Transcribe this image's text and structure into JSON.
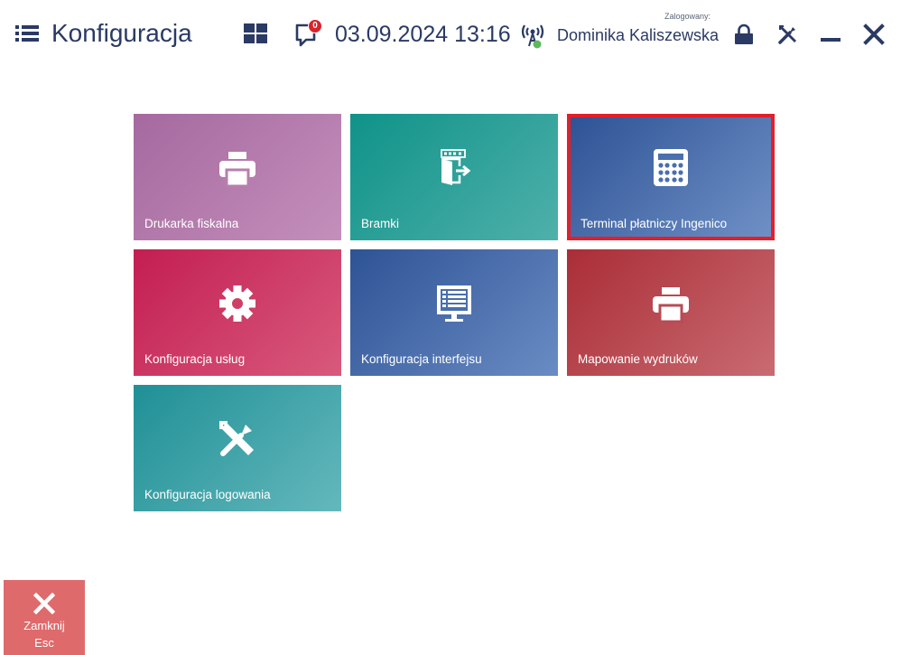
{
  "header": {
    "title": "Konfiguracja",
    "datetime": "03.09.2024 13:16",
    "notification_count": "0",
    "logged_in_label": "Zalogowany:",
    "user_name": "Dominika Kaliszewska"
  },
  "tiles": [
    {
      "label": "Drukarka fiskalna",
      "icon": "printer-icon",
      "color": "#b77fae"
    },
    {
      "label": "Bramki",
      "icon": "gate-exit-icon",
      "color": "#2aa39b"
    },
    {
      "label": "Terminal płatniczy Ingenico",
      "icon": "calculator-icon",
      "color": "#4a6fad",
      "selected": true
    },
    {
      "label": "Konfiguracja usług",
      "icon": "gear-icon",
      "color": "#cf3e66"
    },
    {
      "label": "Konfiguracja interfejsu",
      "icon": "monitor-list-icon",
      "color": "#4a6fad"
    },
    {
      "label": "Mapowanie wydruków",
      "icon": "printer-icon",
      "color": "#b94b53"
    },
    {
      "label": "Konfiguracja logowania",
      "icon": "tools-icon",
      "color": "#3ea5aa"
    }
  ],
  "footer": {
    "close_label": "Zamknij",
    "close_shortcut": "Esc"
  },
  "colors": {
    "accent": "#2b3a64",
    "selection_border": "#e21f2a",
    "close_button": "#de6a6c",
    "status_online": "#5cb85c"
  }
}
